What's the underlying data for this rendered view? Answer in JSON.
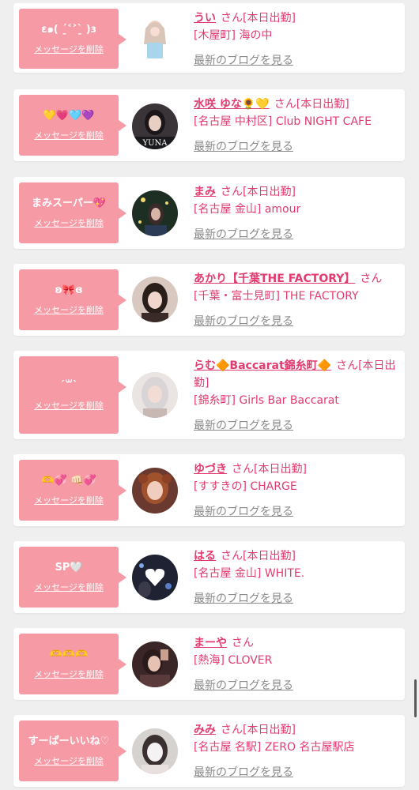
{
  "entries": [
    {
      "message": "ɛ๑( ˊ̱˂˃ˋ̱ )ɜ",
      "delete_label": "メッセージを削除",
      "name": "うい",
      "honorific": "さん",
      "status": "[本日出勤]",
      "shop": "[木屋町] 海の中",
      "blog_label": "最新のブログを見る"
    },
    {
      "message": "💛💗🩵💜",
      "delete_label": "メッセージを削除",
      "name": "水咲 ゆな🌻💛",
      "honorific": "さん",
      "status": "[本日出勤]",
      "shop": "[名古屋 中村区] Club NIGHT CAFE",
      "blog_label": "最新のブログを見る"
    },
    {
      "message": "まみスーパー💖",
      "delete_label": "メッセージを削除",
      "name": "まみ",
      "honorific": "さん",
      "status": "[本日出勤]",
      "shop": "[名古屋 金山] amour",
      "blog_label": "最新のブログを見る"
    },
    {
      "message": "ʚ🎀ɞ",
      "delete_label": "メッセージを削除",
      "name": "あかり【千葉THE FACTORY】",
      "honorific": "さん",
      "status": "",
      "shop": "[千葉・富士見町] THE FACTORY",
      "blog_label": "最新のブログを見る"
    },
    {
      "message": "ˊ꒳ˋ",
      "delete_label": "メッセージを削除",
      "name": "らむ🔶Baccarat錦糸町🔶",
      "honorific": "さん",
      "status": "[本日出勤]",
      "shop": "[錦糸町] Girls Bar Baccarat",
      "blog_label": "最新のブログを見る"
    },
    {
      "message": "🫶💞 👊🏻💞",
      "delete_label": "メッセージを削除",
      "name": "ゆづき",
      "honorific": "さん",
      "status": "[本日出勤]",
      "shop": "[すすきの] CHARGE",
      "blog_label": "最新のブログを見る"
    },
    {
      "message": "SP🤍",
      "delete_label": "メッセージを削除",
      "name": "はる",
      "honorific": "さん",
      "status": "[本日出勤]",
      "shop": "[名古屋 金山] WHITE.",
      "blog_label": "最新のブログを見る"
    },
    {
      "message": "🫶🫶🫶",
      "delete_label": "メッセージを削除",
      "name": "まーや",
      "honorific": "さん",
      "status": "",
      "shop": "[熱海] CLOVER",
      "blog_label": "最新のブログを見る"
    },
    {
      "message": "すーぱーいいね♡",
      "delete_label": "メッセージを削除",
      "name": "みみ",
      "honorific": "さん",
      "status": "[本日出勤]",
      "shop": "[名古屋 名駅] ZERO 名古屋駅店",
      "blog_label": "最新のブログを見る"
    }
  ]
}
